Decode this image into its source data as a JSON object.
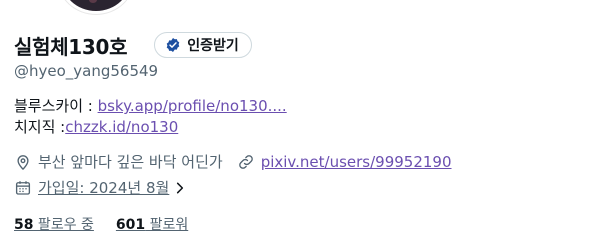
{
  "profile": {
    "display_name": "실험체130호",
    "verified_label": "인증받기",
    "handle": "@hyeo_yang56549"
  },
  "bio": {
    "line1_prefix": "블루스카이 : ",
    "line1_link": "bsky.app/profile/no130....",
    "line2_prefix": "치지직 :",
    "line2_link": "chzzk.id/no130"
  },
  "meta": {
    "location": "부산 앞마다 깊은 바닥 어딘가",
    "website": "pixiv.net/users/99952190",
    "joined": "가입일: 2024년 8월"
  },
  "stats": {
    "following_count": "58",
    "following_label": " 팔로우 중",
    "followers_count": "601",
    "followers_label": " 팔로워"
  },
  "colors": {
    "link": "#6b4fb0",
    "secondary_text": "#536471",
    "verified_badge": "#1d4fa0"
  },
  "icons": [
    "location-pin-icon",
    "link-icon",
    "calendar-icon",
    "chevron-right-icon",
    "verified-badge-icon"
  ]
}
